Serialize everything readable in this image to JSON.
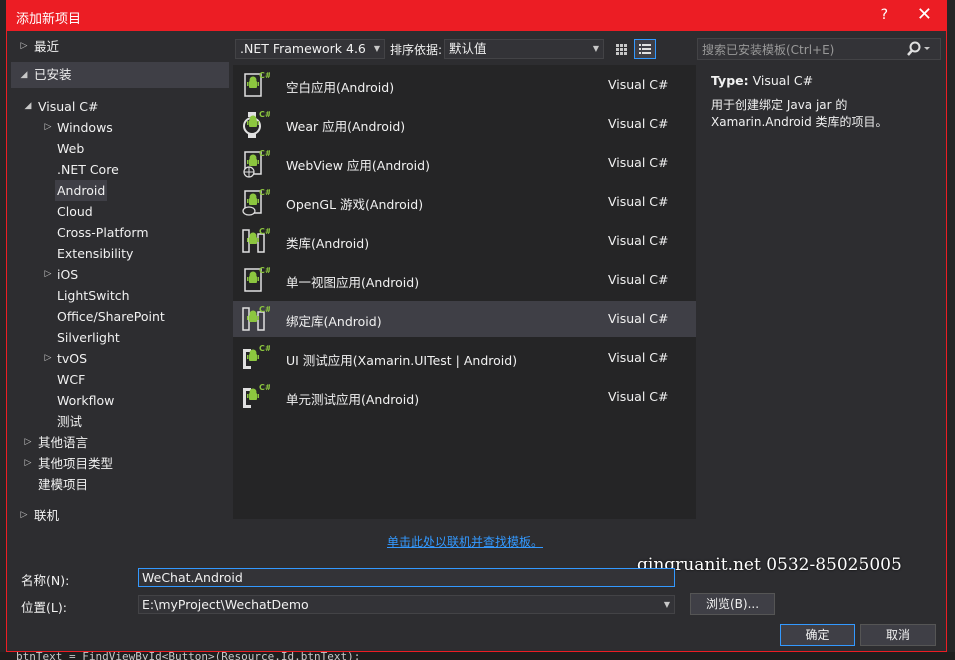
{
  "dialog": {
    "title": "添加新项目",
    "help": "?",
    "close": "✕"
  },
  "tree": [
    {
      "label": "最近",
      "arrow": "▷",
      "indent": 0,
      "header": false,
      "selected": false
    },
    {
      "label": "已安装",
      "arrow": "◢",
      "indent": 0,
      "header": true,
      "selected": false
    },
    {
      "label": "Visual C#",
      "arrow": "◢",
      "indent": 1,
      "header": false,
      "selected": false
    },
    {
      "label": "Windows",
      "arrow": "▷",
      "indent": 2,
      "header": false,
      "selected": false
    },
    {
      "label": "Web",
      "arrow": "",
      "indent": 2,
      "header": false,
      "selected": false
    },
    {
      "label": ".NET Core",
      "arrow": "",
      "indent": 2,
      "header": false,
      "selected": false
    },
    {
      "label": "Android",
      "arrow": "",
      "indent": 2,
      "header": false,
      "selected": true
    },
    {
      "label": "Cloud",
      "arrow": "",
      "indent": 2,
      "header": false,
      "selected": false
    },
    {
      "label": "Cross-Platform",
      "arrow": "",
      "indent": 2,
      "header": false,
      "selected": false
    },
    {
      "label": "Extensibility",
      "arrow": "",
      "indent": 2,
      "header": false,
      "selected": false
    },
    {
      "label": "iOS",
      "arrow": "▷",
      "indent": 2,
      "header": false,
      "selected": false
    },
    {
      "label": "LightSwitch",
      "arrow": "",
      "indent": 2,
      "header": false,
      "selected": false
    },
    {
      "label": "Office/SharePoint",
      "arrow": "",
      "indent": 2,
      "header": false,
      "selected": false
    },
    {
      "label": "Silverlight",
      "arrow": "",
      "indent": 2,
      "header": false,
      "selected": false
    },
    {
      "label": "tvOS",
      "arrow": "▷",
      "indent": 2,
      "header": false,
      "selected": false
    },
    {
      "label": "WCF",
      "arrow": "",
      "indent": 2,
      "header": false,
      "selected": false
    },
    {
      "label": "Workflow",
      "arrow": "",
      "indent": 2,
      "header": false,
      "selected": false
    },
    {
      "label": "测试",
      "arrow": "",
      "indent": 2,
      "header": false,
      "selected": false
    },
    {
      "label": "其他语言",
      "arrow": "▷",
      "indent": 1,
      "header": false,
      "selected": false
    },
    {
      "label": "其他项目类型",
      "arrow": "▷",
      "indent": 1,
      "header": false,
      "selected": false
    },
    {
      "label": "建模项目",
      "arrow": "",
      "indent": 1,
      "header": false,
      "selected": false
    },
    {
      "label": "联机",
      "arrow": "▷",
      "indent": 0,
      "header": false,
      "selected": false
    }
  ],
  "toolbar": {
    "framework": ".NET Framework 4.6",
    "sort_label": "排序依据:",
    "sort_value": "默认值",
    "search_placeholder": "搜索已安装模板(Ctrl+E)"
  },
  "templates": [
    {
      "name": "空白应用(Android)",
      "lang": "Visual C#",
      "icon": "blank-app-icon",
      "selected": false
    },
    {
      "name": "Wear 应用(Android)",
      "lang": "Visual C#",
      "icon": "wear-app-icon",
      "selected": false
    },
    {
      "name": "WebView 应用(Android)",
      "lang": "Visual C#",
      "icon": "webview-app-icon",
      "selected": false
    },
    {
      "name": "OpenGL 游戏(Android)",
      "lang": "Visual C#",
      "icon": "opengl-game-icon",
      "selected": false
    },
    {
      "name": "类库(Android)",
      "lang": "Visual C#",
      "icon": "class-library-icon",
      "selected": false
    },
    {
      "name": "单一视图应用(Android)",
      "lang": "Visual C#",
      "icon": "single-view-app-icon",
      "selected": false
    },
    {
      "name": "绑定库(Android)",
      "lang": "Visual C#",
      "icon": "binding-library-icon",
      "selected": true
    },
    {
      "name": "UI 测试应用(Xamarin.UITest | Android)",
      "lang": "Visual C#",
      "icon": "ui-test-app-icon",
      "selected": false
    },
    {
      "name": "单元测试应用(Android)",
      "lang": "Visual C#",
      "icon": "unit-test-app-icon",
      "selected": false
    }
  ],
  "details": {
    "type_label": "Type:",
    "type_value": "Visual C#",
    "description": "用于创建绑定 Java jar 的 Xamarin.Android 类库的项目。"
  },
  "online_link": "单击此处以联机并查找模板。",
  "watermark": "qingruanit.net 0532-85025005",
  "form": {
    "name_label": "名称(N):",
    "name_value": "WeChat.Android",
    "location_label": "位置(L):",
    "location_value": "E:\\myProject\\WechatDemo",
    "browse": "浏览(B)...",
    "ok": "确定",
    "cancel": "取消"
  },
  "background_code": "btnText = FindViewById<Button>(Resource.Id.btnText);",
  "colors": {
    "titlebar": "#ec1d24",
    "dialog_bg": "#2d2d30",
    "list_bg": "#252526",
    "selection": "#3f3f46",
    "link": "#3399ff",
    "android_green": "#8cc63f"
  }
}
